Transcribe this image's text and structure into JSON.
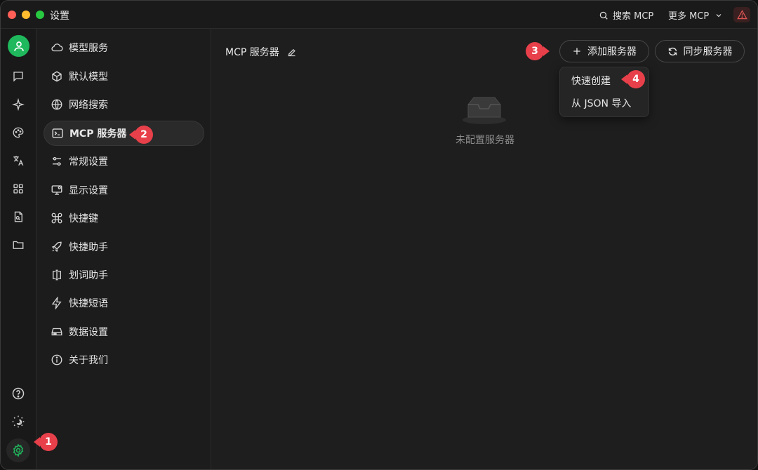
{
  "window": {
    "title": "设置"
  },
  "titlebar": {
    "search_label": "搜索 MCP",
    "more_label": "更多 MCP"
  },
  "menu": {
    "items": [
      {
        "label": "模型服务",
        "icon": "cloud-icon"
      },
      {
        "label": "默认模型",
        "icon": "cube-icon"
      },
      {
        "label": "网络搜索",
        "icon": "globe-icon"
      },
      {
        "label": "MCP 服务器",
        "icon": "terminal-icon",
        "active": true
      },
      {
        "label": "常规设置",
        "icon": "sliders-icon"
      },
      {
        "label": "显示设置",
        "icon": "monitor-icon"
      },
      {
        "label": "快捷键",
        "icon": "command-icon"
      },
      {
        "label": "快捷助手",
        "icon": "rocket-icon"
      },
      {
        "label": "划词助手",
        "icon": "text-select-icon"
      },
      {
        "label": "快捷短语",
        "icon": "zap-icon"
      },
      {
        "label": "数据设置",
        "icon": "hard-drive-icon"
      },
      {
        "label": "关于我们",
        "icon": "info-icon"
      }
    ]
  },
  "main": {
    "title": "MCP 服务器",
    "add_button": "添加服务器",
    "sync_button": "同步服务器",
    "dropdown": {
      "quick_create": "快速创建",
      "import_json": "从 JSON 导入"
    },
    "empty_text": "未配置服务器"
  },
  "markers": {
    "m1": "1",
    "m2": "2",
    "m3": "3",
    "m4": "4"
  },
  "colors": {
    "accent_green": "#1fb85c",
    "marker_red": "#e8404a",
    "warning_red": "#e05555"
  }
}
